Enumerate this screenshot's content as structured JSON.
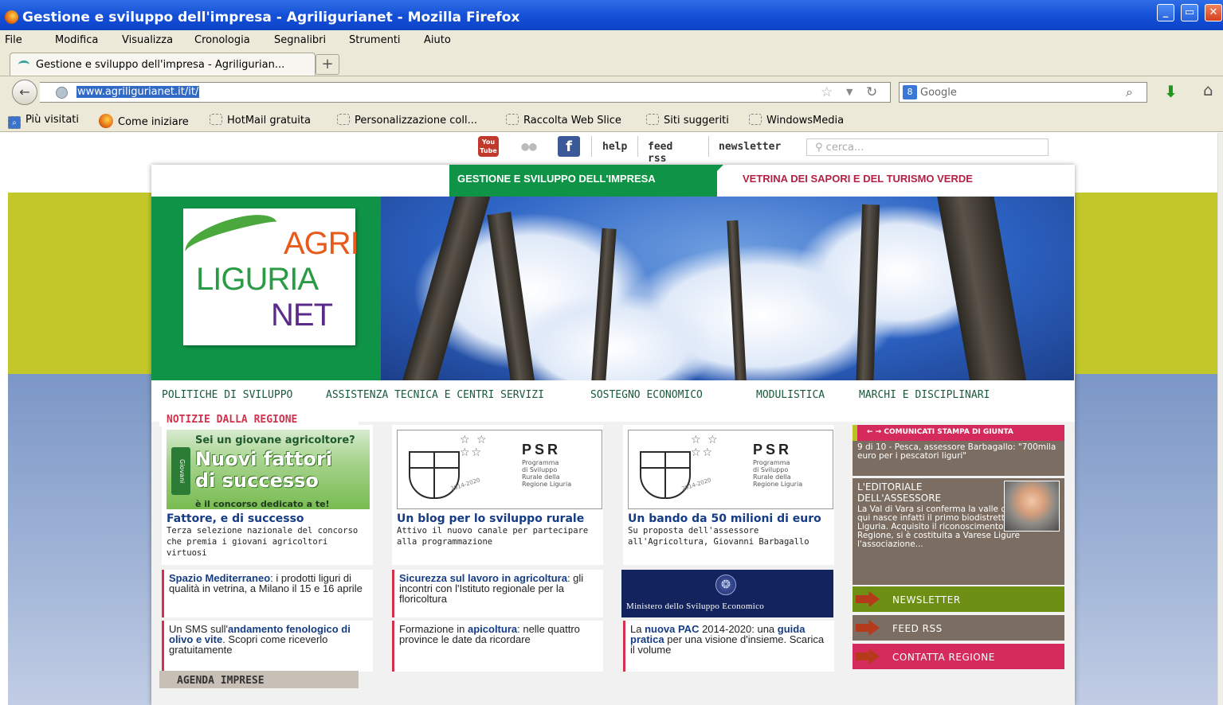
{
  "window": {
    "title": "Gestione e sviluppo dell'impresa - Agriligurianet - Mozilla Firefox",
    "buttons": [
      "_",
      "▭",
      "✕"
    ]
  },
  "menu": [
    "File",
    "Modifica",
    "Visualizza",
    "Cronologia",
    "Segnalibri",
    "Strumenti",
    "Aiuto"
  ],
  "tab": {
    "label": "Gestione e sviluppo dell'impresa - Agriligurian...",
    "new_tab": "+"
  },
  "nav": {
    "url": "www.agriligurianet.it/it/",
    "search_engine": "8",
    "search_placeholder": "Google"
  },
  "bookmarks": [
    "Più visitati",
    "Come iniziare",
    "HotMail gratuita",
    "Personalizzazione coll...",
    "Raccolta Web Slice",
    "Siti suggeriti",
    "WindowsMedia"
  ],
  "site": {
    "tools": {
      "youtube": "You Tube",
      "help": "help",
      "rss": "feed rss",
      "newsletter": "newsletter",
      "search_placeholder": "cerca..."
    },
    "tabs": {
      "active": "GESTIONE E SVILUPPO DELL'IMPRESA",
      "other": "VETRINA DEI SAPORI E DEL TURISMO VERDE"
    },
    "logo": {
      "l1": "AGRI",
      "l2": "LIGURIA",
      "l3": "NET"
    },
    "mainnav": [
      "POLITICHE DI SVILUPPO",
      "ASSISTENZA TECNICA E CENTRI SERVIZI",
      "SOSTEGNO ECONOMICO",
      "MODULISTICA",
      "MARCHI E DISCIPLINARI"
    ],
    "section_news": "NOTIZIE DALLA REGIONE",
    "promo": {
      "question": "Sei un giovane agricoltore?",
      "title1": "Nuovi fattori",
      "title2": "di successo",
      "sub": "è il concorso dedicato a te!",
      "tag": "Giovani"
    },
    "psr": {
      "title": "PSR",
      "sub1": "Programma",
      "sub2": "di Sviluppo",
      "sub3": "Rurale della",
      "sub4": "Regione Liguria",
      "years": "2014-2020"
    },
    "cards": [
      {
        "title": "Fattore, e di successo",
        "text": "Terza selezione nazionale del concorso che premia i giovani agricoltori virtuosi"
      },
      {
        "title": "Un blog per lo sviluppo rurale",
        "text": "Attivo il nuovo canale per partecipare alla programmazione"
      },
      {
        "title": "Un bando da 50 milioni di euro",
        "text": "Su proposta dell'assessore all'Agricoltura, Giovanni Barbagallo"
      }
    ],
    "news": [
      {
        "bold": "Spazio Mediterraneo",
        "rest": ": i prodotti liguri di qualità in vetrina, a Milano il 15 e 16 aprile"
      },
      {
        "pre": "Un SMS sull'",
        "bold": "andamento fenologico di olivo e vite",
        "rest": ". Scopri come riceverlo gratuitamente"
      },
      {
        "bold": "Sicurezza sul lavoro in agricoltura",
        "rest": ": gli incontri con l'Istituto regionale per la floricoltura"
      },
      {
        "pre": "Formazione in ",
        "bold": "apicoltura",
        "rest": ": nelle quattro province le date da ricordare"
      },
      {
        "pre": "La ",
        "bold": "nuova PAC",
        "mid": " 2014-2020: una ",
        "bold2": "guida pratica",
        "rest": " per una visione d'insieme. Scarica il volume"
      }
    ],
    "ministero": "Ministero dello Sviluppo Economico",
    "sidebar": {
      "header": "COMUNICATI STAMPA DI GIUNTA",
      "arrows": "← →",
      "comunicato": "9 di 10 - Pesca, assessore Barbagallo: \"700mila euro per i pescatori liguri\"",
      "editoriale_title": "L'EDITORIALE DELL'ASSESSORE",
      "editoriale_text": "La Val di Vara si conferma la valle del biologico: qui nasce infatti il primo biodistretto della Liguria. Acquisito il riconoscimento della Regione, si è costituita a Varese Ligure l'associazione...",
      "buttons": [
        {
          "label": "NEWSLETTER",
          "color": "#6d8f14"
        },
        {
          "label": "FEED RSS",
          "color": "#7b6d61"
        },
        {
          "label": "CONTATTA REGIONE",
          "color": "#d42a5c"
        }
      ]
    },
    "section_agenda": "AGENDA IMPRESE"
  }
}
